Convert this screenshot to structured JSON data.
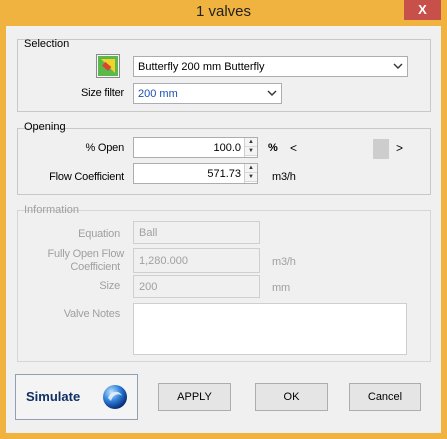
{
  "window": {
    "title": "1 valves",
    "close_glyph": "X"
  },
  "selection": {
    "group_label": "Selection",
    "valve_value": "Butterfly 200 mm Butterfly",
    "size_filter_label": "Size filter",
    "size_filter_value": "200 mm"
  },
  "opening": {
    "group_label": "Opening",
    "percent_open_label": "% Open",
    "percent_open_value": "100.0",
    "percent_unit": "%",
    "slider_left_glyph": "<",
    "slider_right_glyph": ">",
    "slider_level": 1.0,
    "flow_coeff_label": "Flow Coefficient",
    "flow_coeff_value": "571.73",
    "flow_coeff_unit": "m3/h"
  },
  "information": {
    "group_label": "Information",
    "equation_label": "Equation",
    "equation_value": "Ball",
    "fully_open_label_1": "Fully Open Flow",
    "fully_open_label_2": "Coefficient",
    "fully_open_value": "1,280.000",
    "fully_open_unit": "m3/h",
    "size_label": "Size",
    "size_value": "200",
    "size_unit": "mm",
    "notes_label": "Valve Notes",
    "notes_value": ""
  },
  "footer": {
    "simulate_label": "Simulate",
    "apply_label": "APPLY",
    "ok_label": "OK",
    "cancel_label": "Cancel"
  },
  "colors": {
    "title_bar": "#f0b33f",
    "close_button": "#c7504a",
    "dialog_bg": "#f0f0f0",
    "value_blue": "#1a50b0"
  },
  "icons": {
    "valve_picker": "valve-picker-icon",
    "simulate": "simulate-globe-icon"
  }
}
